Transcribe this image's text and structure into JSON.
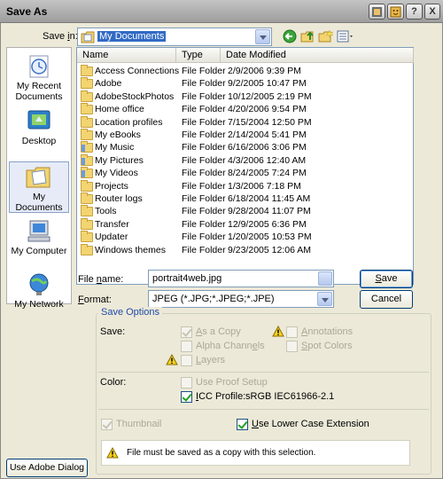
{
  "title": "Save As",
  "title_buttons": [
    "Adobe",
    "Help-browse",
    "?",
    "X"
  ],
  "save_in": {
    "label_pre": "Save ",
    "label_u": "i",
    "label_post": "n:",
    "value": "My Documents"
  },
  "places": [
    {
      "label": "My Recent Documents",
      "icon": "recent-documents-icon"
    },
    {
      "label": "Desktop",
      "icon": "desktop-icon"
    },
    {
      "label": "My Documents",
      "icon": "my-documents-icon"
    },
    {
      "label": "My Computer",
      "icon": "my-computer-icon"
    },
    {
      "label": "My Network",
      "icon": "my-network-icon"
    }
  ],
  "columns": [
    "Name",
    "Type",
    "Date Modified"
  ],
  "files": [
    {
      "name": "Access Connections",
      "type": "File Folder",
      "date": "2/9/2006 9:39 PM",
      "icon": "folder-icon"
    },
    {
      "name": "Adobe",
      "type": "File Folder",
      "date": "9/2/2005 10:47 PM",
      "icon": "folder-icon"
    },
    {
      "name": "AdobeStockPhotos",
      "type": "File Folder",
      "date": "10/12/2005 2:19 PM",
      "icon": "folder-icon"
    },
    {
      "name": "Home office",
      "type": "File Folder",
      "date": "4/20/2006 9:54 PM",
      "icon": "folder-icon"
    },
    {
      "name": "Location profiles",
      "type": "File Folder",
      "date": "7/15/2004 12:50 PM",
      "icon": "folder-icon"
    },
    {
      "name": "My eBooks",
      "type": "File Folder",
      "date": "2/14/2004 5:41 PM",
      "icon": "folder-icon"
    },
    {
      "name": "My Music",
      "type": "File Folder",
      "date": "6/16/2006 3:06 PM",
      "icon": "music-folder-icon"
    },
    {
      "name": "My Pictures",
      "type": "File Folder",
      "date": "4/3/2006 12:40 AM",
      "icon": "pictures-folder-icon"
    },
    {
      "name": "My Videos",
      "type": "File Folder",
      "date": "8/24/2005 7:24 PM",
      "icon": "videos-folder-icon"
    },
    {
      "name": "Projects",
      "type": "File Folder",
      "date": "1/3/2006 7:18 PM",
      "icon": "folder-icon"
    },
    {
      "name": "Router logs",
      "type": "File Folder",
      "date": "6/18/2004 11:45 AM",
      "icon": "folder-icon"
    },
    {
      "name": "Tools",
      "type": "File Folder",
      "date": "9/28/2004 11:07 PM",
      "icon": "folder-icon"
    },
    {
      "name": "Transfer",
      "type": "File Folder",
      "date": "12/9/2005 6:36 PM",
      "icon": "folder-icon"
    },
    {
      "name": "Updater",
      "type": "File Folder",
      "date": "1/20/2005 10:53 PM",
      "icon": "folder-icon"
    },
    {
      "name": "Windows themes",
      "type": "File Folder",
      "date": "9/23/2005 12:06 AM",
      "icon": "folder-icon"
    }
  ],
  "file_name": {
    "label_pre": "File ",
    "label_u": "n",
    "label_post": "ame:",
    "value": "portrait4web.jpg"
  },
  "format": {
    "label_u": "F",
    "label_post": "ormat:",
    "value": "JPEG (*.JPG;*.JPEG;*.JPE)"
  },
  "buttons": {
    "save_u": "S",
    "save_post": "ave",
    "cancel": "Cancel",
    "adobe_dialog": "Use Adobe Dialog"
  },
  "save_options": {
    "title": "Save Options",
    "save_label": "Save:",
    "as_a_copy": {
      "u": "A",
      "post": "s a Copy",
      "checked": true,
      "enabled": false
    },
    "alpha_channels": {
      "pre": "Alpha Chann",
      "u": "e",
      "post": "ls",
      "checked": false,
      "enabled": false
    },
    "layers": {
      "u": "L",
      "post": "ayers",
      "checked": false,
      "enabled": false
    },
    "annotations": {
      "u": "A",
      "post": "nnotations",
      "checked": false,
      "enabled": false
    },
    "spot_colors": {
      "u": "S",
      "post": "pot Colors",
      "checked": false,
      "enabled": false
    },
    "color_label": "Color:",
    "use_proof_setup": {
      "label": "Use Proof Setup",
      "checked": false,
      "enabled": false
    },
    "icc_profile": {
      "u": "I",
      "post": "CC Profile:",
      "value": "sRGB IEC61966-2.1",
      "checked": true,
      "enabled": true
    },
    "thumbnail": {
      "label": "Thumbnail",
      "checked": true,
      "enabled": false
    },
    "lower_case": {
      "u": "U",
      "post": "se Lower Case Extension",
      "checked": true,
      "enabled": true
    },
    "warning_message": "File must be saved as a copy with this selection."
  },
  "colors": {
    "accent": "#1f4aa8",
    "folder": "#f2d471",
    "disabled_text": "#aca899",
    "check": "#21a121"
  }
}
